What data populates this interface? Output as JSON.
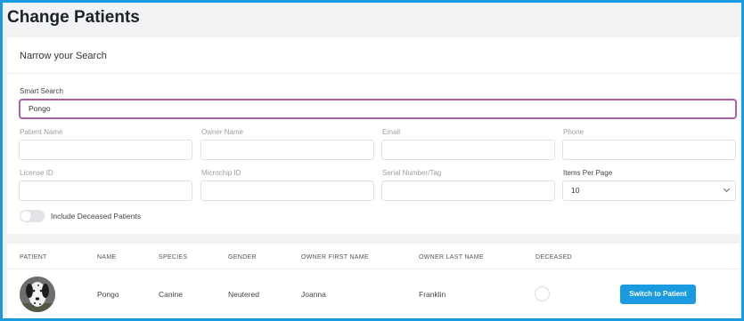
{
  "header": {
    "title": "Change Patients"
  },
  "search": {
    "section_title": "Narrow your Search",
    "smart_search": {
      "label": "Smart Search",
      "value": "Pongo"
    },
    "fields": {
      "patient_name": {
        "label": "Patient Name",
        "value": ""
      },
      "owner_name": {
        "label": "Owner Name",
        "value": ""
      },
      "email": {
        "label": "Email",
        "value": ""
      },
      "phone": {
        "label": "Phone",
        "value": ""
      },
      "license_id": {
        "label": "License ID",
        "value": ""
      },
      "microchip_id": {
        "label": "Microchip ID",
        "value": ""
      },
      "serial_number": {
        "label": "Serial Number/Tag",
        "value": ""
      }
    },
    "items_per_page": {
      "label": "Items Per Page",
      "value": "10"
    },
    "include_deceased": {
      "label": "Include Deceased Patients",
      "checked": false
    }
  },
  "table": {
    "columns": [
      "PATIENT",
      "NAME",
      "SPECIES",
      "GENDER",
      "OWNER FIRST NAME",
      "OWNER LAST NAME",
      "DECEASED"
    ],
    "rows": [
      {
        "name": "Pongo",
        "species": "Canine",
        "gender": "Neutered",
        "owner_first": "Joanna",
        "owner_last": "Franklin",
        "deceased": false,
        "action_label": "Switch to Patient"
      }
    ]
  },
  "colors": {
    "accent": "#1a9be0",
    "focus_border": "#a7629f"
  },
  "icons": {
    "avatar": "dalmatian-photo-avatar",
    "select": "chevron-down-icon"
  }
}
